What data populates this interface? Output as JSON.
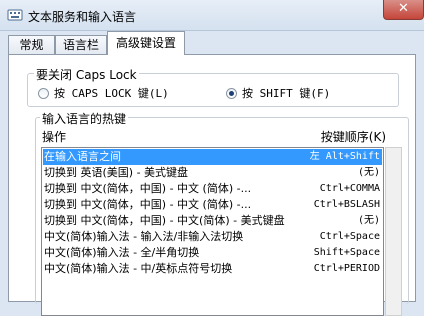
{
  "window": {
    "title": "文本服务和输入语言",
    "close_symbol": "✕"
  },
  "tabs": [
    {
      "label": "常规",
      "active": false
    },
    {
      "label": "语言栏",
      "active": false
    },
    {
      "label": "高级键设置",
      "active": true
    }
  ],
  "caps_group": {
    "title": "要关闭 Caps Lock",
    "options": [
      {
        "label": "按 CAPS LOCK 键(L)",
        "selected": false
      },
      {
        "label": "按 SHIFT 键(F)",
        "selected": true
      }
    ]
  },
  "hotkey_group": {
    "title": "输入语言的热键",
    "col_action": "操作",
    "col_key": "按键顺序(K)",
    "rows": [
      {
        "name": "在输入语言之间",
        "key": "左 Alt+Shift",
        "selected": true
      },
      {
        "name": "切换到 英语(美国) - 美式键盘",
        "key": "(无)"
      },
      {
        "name": "切换到 中文(简体，中国) - 中文 (简体) -...",
        "key": "Ctrl+COMMA"
      },
      {
        "name": "切换到 中文(简体，中国) - 中文 (简体) -...",
        "key": "Ctrl+BSLASH"
      },
      {
        "name": "切换到 中文(简体，中国) - 中文(简体) - 美式键盘",
        "key": "(无)"
      },
      {
        "name": "中文(简体)输入法 - 输入法/非输入法切换",
        "key": "Ctrl+Space"
      },
      {
        "name": "中文(简体)输入法 - 全/半角切换",
        "key": "Shift+Space"
      },
      {
        "name": "中文(简体)输入法 - 中/英标点符号切换",
        "key": "Ctrl+PERIOD"
      }
    ]
  },
  "colors": {
    "selection": "#3399ff",
    "window_frame": "#dbe6f2"
  }
}
